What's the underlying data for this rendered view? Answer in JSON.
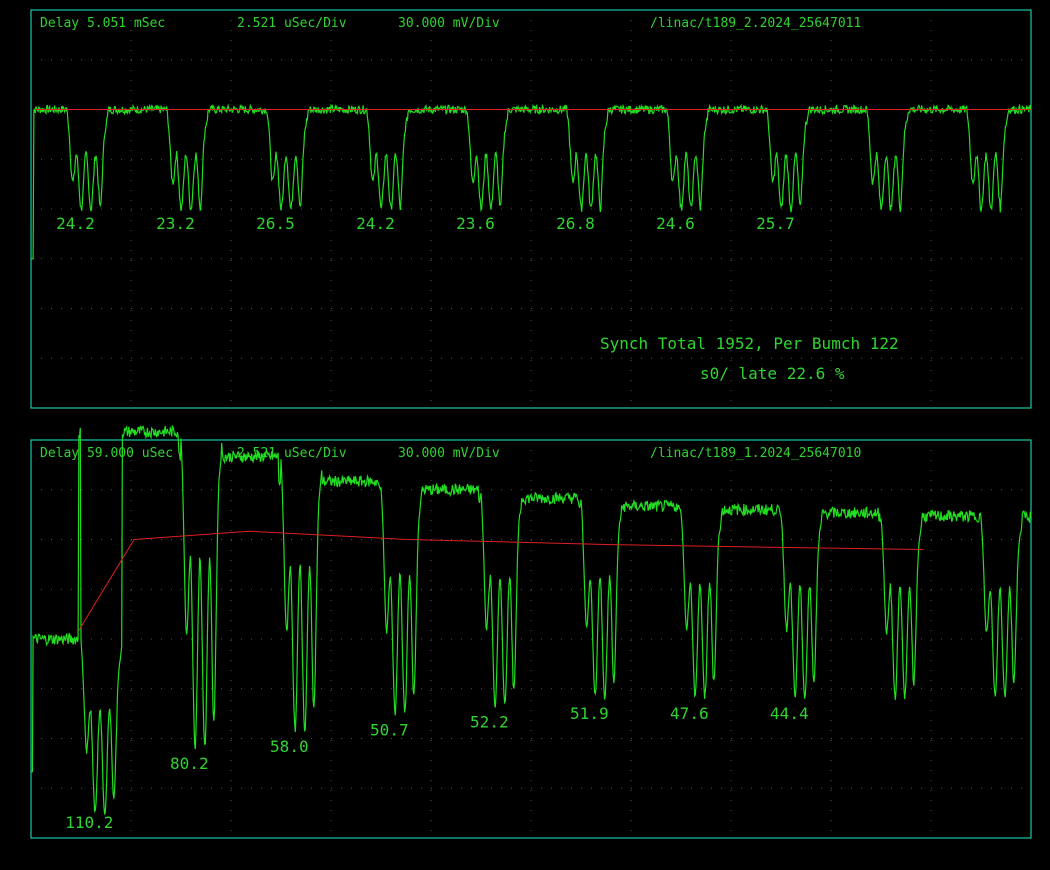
{
  "colors": {
    "frame": "#18c9a8",
    "grid": "#555555",
    "text": "#2fd42f",
    "trace": "#22dd22",
    "envelope": "#dd2020",
    "background": "#000000"
  },
  "chart_data": [
    {
      "type": "line",
      "header": {
        "delay": "Delay  5.051 mSec",
        "timebase": "2.521 uSec/Div",
        "volts": "30.000 mV/Div",
        "file": "/linac/t189_2.2024_25647011"
      },
      "grid": true,
      "divisions": {
        "x": 10,
        "y": 8
      },
      "xlim": [
        0,
        25.21
      ],
      "ylim": [
        -120,
        120
      ],
      "x_unit": "uSec",
      "y_unit": "mV",
      "baseline_mV": 60,
      "bunch_period_us": 2.521,
      "first_bunch_us": 0.9,
      "bunch_width_us": 1.05,
      "bunch_depths_mV": [
        60,
        60,
        60,
        60,
        60,
        60,
        60,
        60,
        60,
        60
      ],
      "envelope": [
        [
          0.1,
          60
        ],
        [
          25.2,
          60
        ]
      ],
      "bunch_labels": [
        "24.2",
        "23.2",
        "26.5",
        "24.2",
        "23.6",
        "26.8",
        "24.6",
        "25.7"
      ],
      "annotations": [
        "Synch Total 1952, Per Bumch  122",
        "s0/ late  22.6 %"
      ]
    },
    {
      "type": "line",
      "header": {
        "delay": "Delay 59.000 uSec",
        "timebase": "2.521 uSec/Div",
        "volts": "30.000 mV/Div",
        "file": "/linac/t189_1.2024_25647010"
      },
      "grid": true,
      "divisions": {
        "x": 10,
        "y": 8
      },
      "xlim": [
        0,
        25.21
      ],
      "ylim": [
        -120,
        120
      ],
      "x_unit": "uSec",
      "y_unit": "mV",
      "bunch_period_us": 2.521,
      "first_bunch_us": 1.25,
      "bunch_width_us": 1.05,
      "bunch_peaks_mV": [
        -105,
        -65,
        -55,
        -45,
        -40,
        -35,
        -35,
        -35,
        -35,
        -35
      ],
      "bunch_baselines_mV": [
        0,
        125,
        110,
        95,
        90,
        85,
        80,
        78,
        76,
        74
      ],
      "envelope": [
        [
          1.2,
          5
        ],
        [
          2.6,
          60
        ],
        [
          5.5,
          65
        ],
        [
          9.5,
          60
        ],
        [
          14.5,
          57
        ],
        [
          19.5,
          55
        ],
        [
          22.5,
          54
        ]
      ],
      "bunch_labels": [
        "110.2",
        "80.2",
        "58.0",
        "50.7",
        "52.2",
        "51.9",
        "47.6",
        "44.4"
      ]
    }
  ]
}
